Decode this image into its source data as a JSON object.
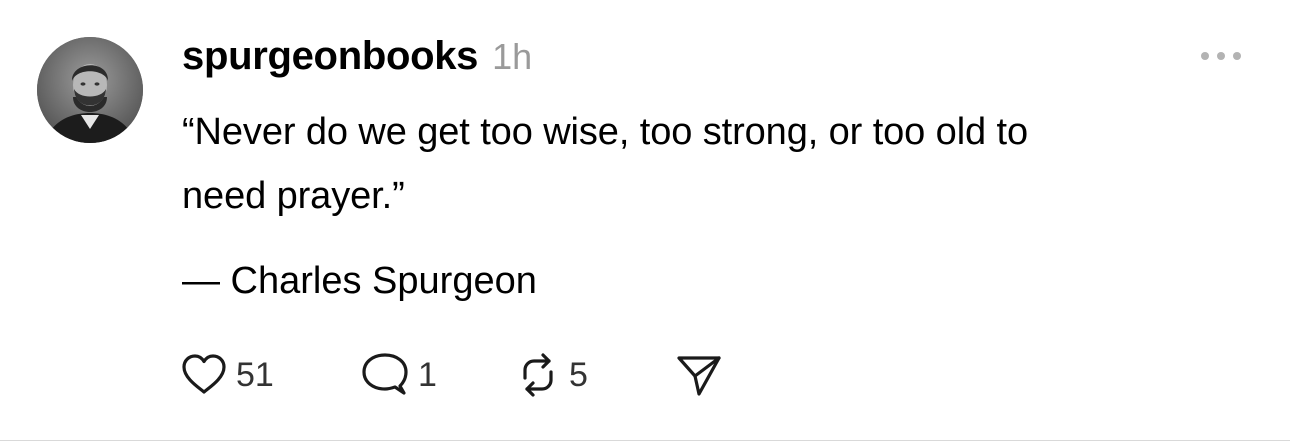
{
  "post": {
    "username": "spurgeonbooks",
    "timestamp": "1h",
    "body_lines": [
      "“Never do we get too wise, too strong, or too old to",
      "need prayer.”"
    ],
    "attribution": "— Charles Spurgeon",
    "actions": {
      "like_count": "51",
      "reply_count": "1",
      "repost_count": "5"
    }
  },
  "icons": {
    "avatar": "profile-photo",
    "more": "more-options-icon",
    "like": "heart-icon",
    "reply": "comment-bubble-icon",
    "repost": "repost-arrows-icon",
    "share": "send-paper-plane-icon"
  },
  "colors": {
    "text": "#000000",
    "muted": "#9a9a9a",
    "icon": "#1a1a1a",
    "divider": "#d9d9d9",
    "background": "#ffffff"
  }
}
